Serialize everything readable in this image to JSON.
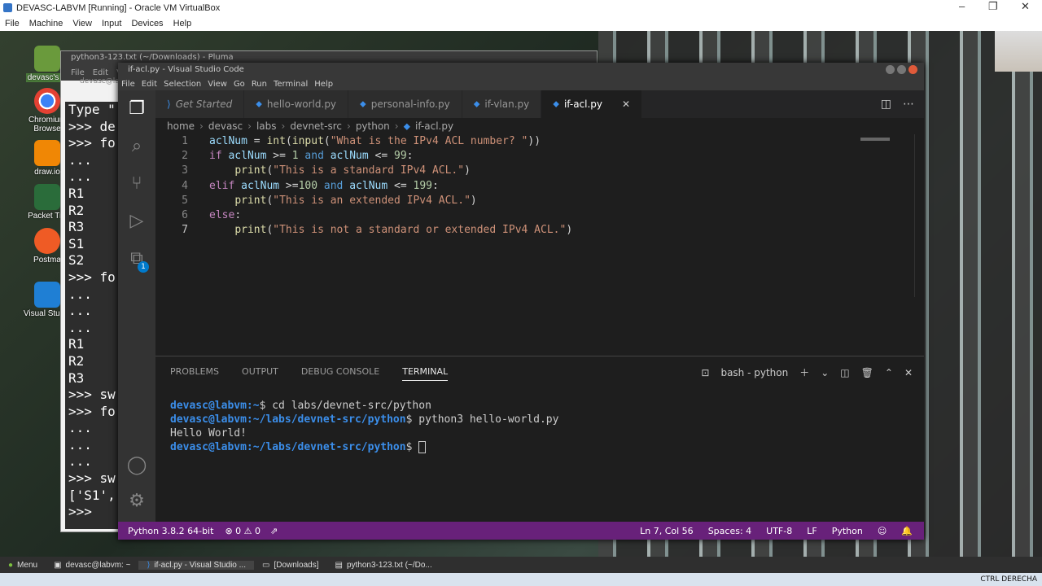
{
  "vbox": {
    "title": "DEVASC-LABVM [Running] - Oracle VM VirtualBox",
    "menu": [
      "File",
      "Machine",
      "View",
      "Input",
      "Devices",
      "Help"
    ],
    "host_key": "CTRL DERECHA"
  },
  "desktop": {
    "icons": [
      {
        "label": "devasc's H",
        "icon": "home-folder-icon"
      },
      {
        "label": "Chromium Browse",
        "icon": "chromium-icon"
      },
      {
        "label": "draw.io",
        "icon": "drawio-icon"
      },
      {
        "label": "Packet Tra",
        "icon": "packet-tracer-icon"
      },
      {
        "label": "Postma",
        "icon": "postman-icon"
      },
      {
        "label": "Visual Studio",
        "icon": "vscode-icon"
      }
    ]
  },
  "pluma": {
    "title": "python3-123.txt (~/Downloads) - Pluma",
    "menu": [
      "File",
      "Edit",
      "V"
    ],
    "behind_label": "devasc@la"
  },
  "terminal_bg_lines": [
    "Type \"",
    ">>> de",
    ">>> fo",
    "...",
    "...",
    "R1",
    "R2",
    "R3",
    "S1",
    "S2",
    ">>> fo",
    "...",
    "...",
    "...",
    "R1",
    "R2",
    "R3",
    ">>> sw",
    ">>> fo",
    "...",
    "...",
    "...",
    ">>> sw",
    "['S1',",
    ">>> "
  ],
  "vscode": {
    "title": "if-acl.py - Visual Studio Code",
    "menu": [
      "File",
      "Edit",
      "Selection",
      "View",
      "Go",
      "Run",
      "Terminal",
      "Help"
    ],
    "tabs": [
      {
        "label": "Get Started",
        "icon": "vscode-logo-icon",
        "active": false
      },
      {
        "label": "hello-world.py",
        "icon": "python-file-icon",
        "active": false
      },
      {
        "label": "personal-info.py",
        "icon": "python-file-icon",
        "active": false
      },
      {
        "label": "if-vlan.py",
        "icon": "python-file-icon",
        "active": false
      },
      {
        "label": "if-acl.py",
        "icon": "python-file-icon",
        "active": true
      }
    ],
    "breadcrumb": [
      "home",
      "devasc",
      "labs",
      "devnet-src",
      "python",
      "if-acl.py"
    ],
    "extensions_badge": "1",
    "code_lines": [
      {
        "num": "1",
        "html_tokens": [
          [
            "v",
            "aclNum"
          ],
          [
            "o",
            " = "
          ],
          [
            "f",
            "int"
          ],
          [
            "o",
            "("
          ],
          [
            "f",
            "input"
          ],
          [
            "o",
            "("
          ],
          [
            "s",
            "\"What is the IPv4 ACL number? \""
          ],
          [
            "o",
            "))"
          ]
        ]
      },
      {
        "num": "2",
        "html_tokens": [
          [
            "kc",
            "if"
          ],
          [
            "o",
            " "
          ],
          [
            "v",
            "aclNum"
          ],
          [
            "o",
            " >= "
          ],
          [
            "n",
            "1"
          ],
          [
            "o",
            " "
          ],
          [
            "k",
            "and"
          ],
          [
            "o",
            " "
          ],
          [
            "v",
            "aclNum"
          ],
          [
            "o",
            " <= "
          ],
          [
            "n",
            "99"
          ],
          [
            "o",
            ":"
          ]
        ]
      },
      {
        "num": "3",
        "html_tokens": [
          [
            "o",
            "    "
          ],
          [
            "f",
            "print"
          ],
          [
            "o",
            "("
          ],
          [
            "s",
            "\"This is a standard IPv4 ACL.\""
          ],
          [
            "o",
            ")"
          ]
        ]
      },
      {
        "num": "4",
        "html_tokens": [
          [
            "kc",
            "elif"
          ],
          [
            "o",
            " "
          ],
          [
            "v",
            "aclNum"
          ],
          [
            "o",
            " >="
          ],
          [
            "n",
            "100"
          ],
          [
            "o",
            " "
          ],
          [
            "k",
            "and"
          ],
          [
            "o",
            " "
          ],
          [
            "v",
            "aclNum"
          ],
          [
            "o",
            " <= "
          ],
          [
            "n",
            "199"
          ],
          [
            "o",
            ":"
          ]
        ]
      },
      {
        "num": "5",
        "html_tokens": [
          [
            "o",
            "    "
          ],
          [
            "f",
            "print"
          ],
          [
            "o",
            "("
          ],
          [
            "s",
            "\"This is an extended IPv4 ACL.\""
          ],
          [
            "o",
            ")"
          ]
        ]
      },
      {
        "num": "6",
        "html_tokens": [
          [
            "kc",
            "else"
          ],
          [
            "o",
            ":"
          ]
        ]
      },
      {
        "num": "7",
        "html_tokens": [
          [
            "o",
            "    "
          ],
          [
            "f",
            "print"
          ],
          [
            "o",
            "("
          ],
          [
            "s",
            "\"This is not a standard or extended IPv4 ACL.\""
          ],
          [
            "o",
            ")"
          ]
        ]
      }
    ],
    "panel_tabs": [
      "PROBLEMS",
      "OUTPUT",
      "DEBUG CONSOLE",
      "TERMINAL"
    ],
    "terminal_name": "bash - python",
    "terminal_lines": [
      {
        "user": "devasc@labvm",
        "path": ":~",
        "cmd": "$ cd labs/devnet-src/python"
      },
      {
        "user": "devasc@labvm",
        "path": ":~/labs/devnet-src/python",
        "cmd": "$ python3 hello-world.py"
      },
      {
        "output": "Hello World!"
      },
      {
        "user": "devasc@labvm",
        "path": ":~/labs/devnet-src/python",
        "cmd": "$ "
      }
    ],
    "status": {
      "interpreter": "Python 3.8.2 64-bit",
      "problems": "⊗ 0 ⚠ 0",
      "position": "Ln 7, Col 56",
      "spaces": "Spaces: 4",
      "encoding": "UTF-8",
      "eol": "LF",
      "language": "Python"
    }
  },
  "taskbar": {
    "items": [
      "Menu",
      "devasc@labvm: ~",
      "if-acl.py - Visual Studio ...",
      "[Downloads]",
      "python3-123.txt (~/Do..."
    ]
  },
  "colors": {
    "status_bar": "#68217a",
    "editor_bg": "#1e1e1e",
    "activity_bar": "#333333"
  }
}
